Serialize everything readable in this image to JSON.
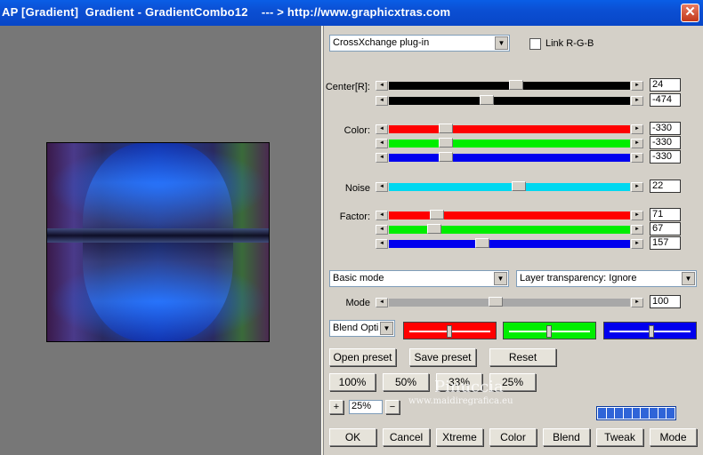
{
  "window": {
    "title": "AP [Gradient]  Gradient - GradientCombo12    --- > http://www.graphicxtras.com",
    "close": "✕"
  },
  "plugin_dropdown": {
    "value": "CrossXchange plug-in"
  },
  "link_rgb": {
    "label": "Link R-G-B",
    "checked": false
  },
  "center": {
    "label": "Center[R]:",
    "values": [
      "24",
      "-474"
    ],
    "levels": [
      0.53,
      0.4
    ]
  },
  "color": {
    "label": "Color:",
    "values": [
      "-330",
      "-330",
      "-330"
    ],
    "levels": [
      0.22,
      0.22,
      0.22
    ]
  },
  "noise": {
    "label": "Noise",
    "value": "22",
    "level": 0.54
  },
  "factor": {
    "label": "Factor:",
    "values": [
      "71",
      "67",
      "157"
    ],
    "levels": [
      0.18,
      0.17,
      0.38
    ]
  },
  "mode_dropdown": {
    "value": "Basic mode"
  },
  "transparency_dropdown": {
    "value": "Layer transparency: Ignore"
  },
  "mode_slider": {
    "label": "Mode",
    "value": "100",
    "level": 0.44
  },
  "blend_dropdown": {
    "value": "Blend Opti"
  },
  "buttons": {
    "open_preset": "Open preset",
    "save_preset": "Save preset",
    "reset": "Reset",
    "z100": "100%",
    "z50": "50%",
    "z33": "33%",
    "z25": "25%",
    "plus": "+",
    "minus": "−",
    "zoom_value": "25%",
    "ok": "OK",
    "cancel": "Cancel",
    "xtreme": "Xtreme",
    "color": "Color",
    "blend": "Blend",
    "tweak": "Tweak",
    "mode": "Mode"
  },
  "watermark": {
    "name": "Pinuccia",
    "url": "www.maidiregrafica.eu"
  },
  "colors": {
    "red": "#ff0000",
    "green": "#00ee00",
    "blue": "#0000ee",
    "cyan": "#00d8f0",
    "black": "#000000"
  }
}
